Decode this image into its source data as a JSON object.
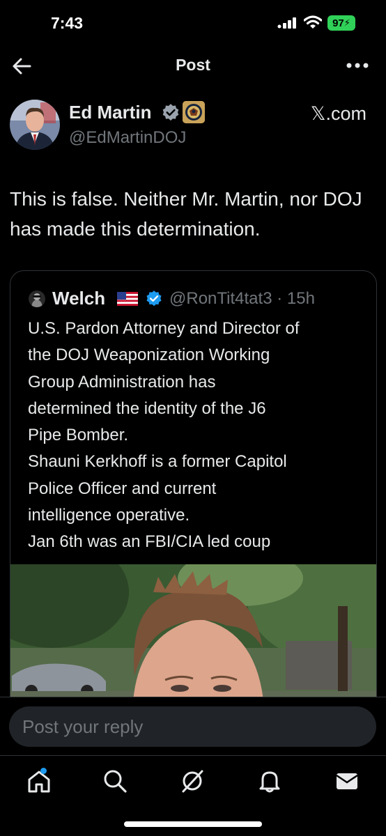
{
  "status_bar": {
    "time": "7:43",
    "battery": "97"
  },
  "nav": {
    "title": "Post"
  },
  "author": {
    "name": "Ed Martin",
    "handle": "@EdMartinDOJ",
    "source": "𝕏.com"
  },
  "post": {
    "text": "This is false. Neither Mr. Martin, nor DOJ has made this determination."
  },
  "quoted": {
    "name": "Welch",
    "handle_time": "@RonTit4tat3 · 15h",
    "text_lines": [
      "U.S. Pardon Attorney and Director of",
      "the DOJ Weaponization Working",
      "Group Administration has",
      "determined the identity of the J6",
      "Pipe Bomber.",
      "Shauni Kerkhoff is a former Capitol",
      "Police Officer and current",
      "intelligence operative.",
      "Jan 6th was an FBI/CIA led coup"
    ]
  },
  "reply": {
    "placeholder": "Post your reply"
  },
  "icons": {
    "back": "arrow-left-icon",
    "more": "more-dots-icon",
    "verified": "verified-badge-icon",
    "home": "home-icon",
    "search": "search-icon",
    "grok": "grok-icon",
    "notifications": "bell-icon",
    "messages": "mail-icon"
  },
  "colors": {
    "accent": "#1d9bf0",
    "muted": "#71767b",
    "battery": "#30d158"
  }
}
